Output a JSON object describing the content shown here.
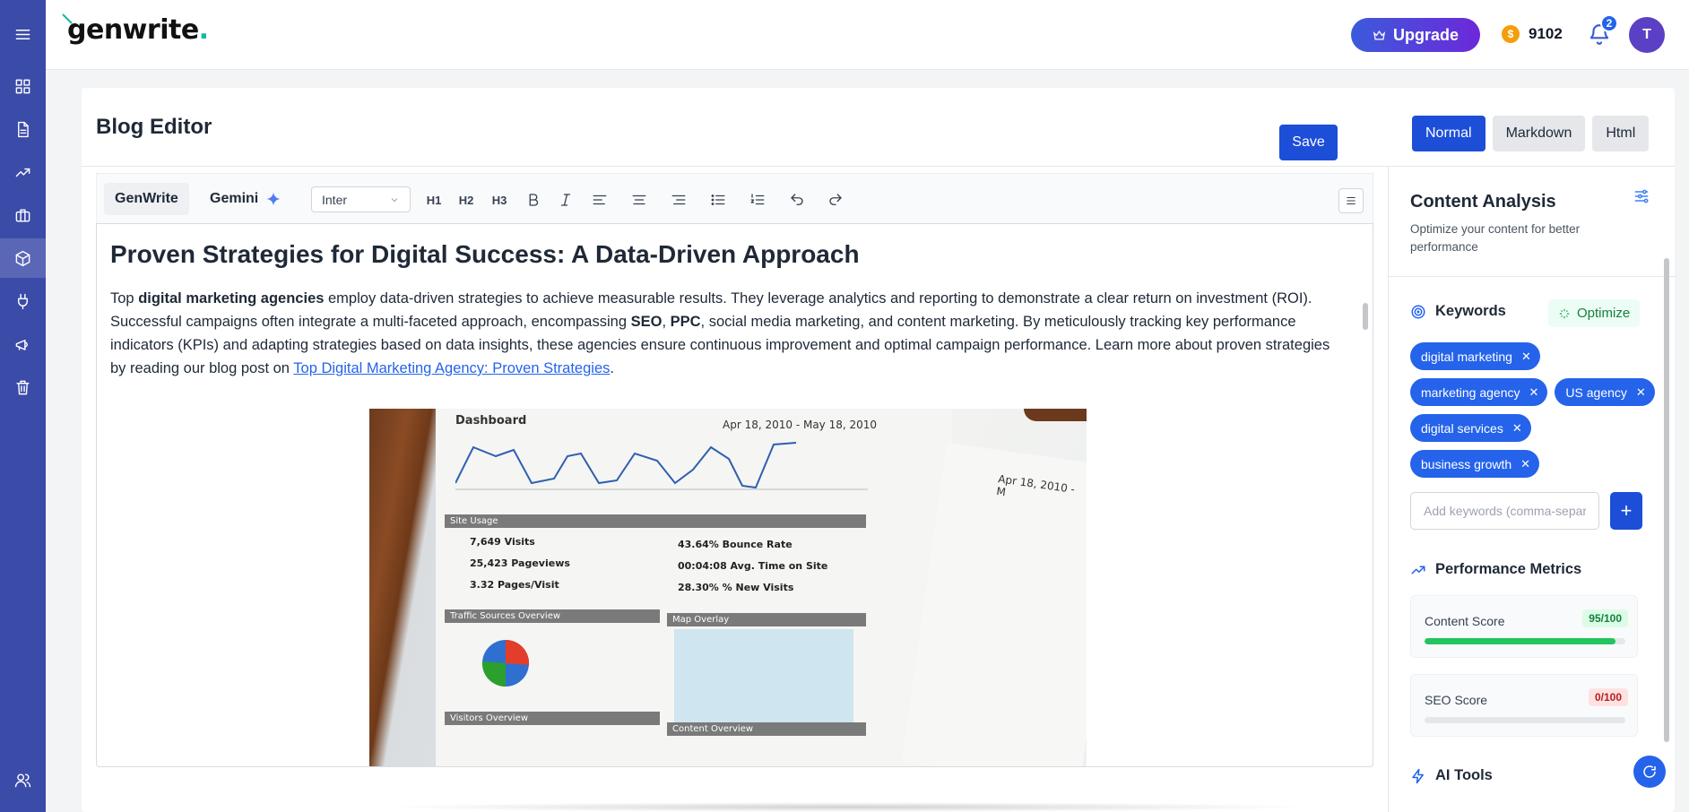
{
  "app": {
    "logo_text": "genwrite",
    "logo_dot": "."
  },
  "topbar": {
    "upgrade_label": "Upgrade",
    "credits": "9102",
    "notifications_count": "2",
    "avatar_initial": "T"
  },
  "editor": {
    "page_title": "Blog Editor",
    "save_label": "Save",
    "modes": [
      {
        "label": "Normal",
        "active": true
      },
      {
        "label": "Markdown",
        "active": false
      },
      {
        "label": "Html",
        "active": false
      }
    ],
    "tabs": {
      "genwrite": "GenWrite",
      "gemini": "Gemini"
    },
    "font": "Inter",
    "toolbar_headings": [
      "H1",
      "H2",
      "H3"
    ]
  },
  "article": {
    "title": "Proven Strategies for Digital Success: A Data-Driven Approach",
    "p_1": "Top ",
    "p_b1": "digital marketing agencies",
    "p_2": " employ data-driven strategies to achieve measurable results. They leverage analytics and reporting to demonstrate a clear return on investment (ROI). Successful campaigns often integrate a multi-faceted approach, encompassing ",
    "p_b2": "SEO",
    "p_3": ", ",
    "p_b3": "PPC",
    "p_4": ", social media marketing, and content marketing. By meticulously tracking key performance indicators (KPIs) and adapting strategies based on data insights, these agencies ensure continuous improvement and optimal campaign performance. Learn more about proven strategies by reading our blog post on ",
    "p_link": "Top Digital Marketing Agency: Proven Strategies",
    "p_5": "."
  },
  "photo": {
    "dash_title": "Dashboard",
    "dash_date": "Apr 18, 2010 - May 18, 2010",
    "site_usage": "Site Usage",
    "stats": [
      "7,649 Visits",
      "25,423 Pageviews",
      "3.32 Pages/Visit",
      "43.64% Bounce Rate",
      "00:04:08 Avg. Time on Site",
      "28.30% % New Visits"
    ],
    "traffic": "Traffic Sources Overview",
    "map": "Map Overlay",
    "visitors": "Visitors Overview",
    "content": "Content Overview",
    "date2": "Apr 18, 2010 - M"
  },
  "panel": {
    "title": "Content Analysis",
    "subtitle": "Optimize your content for better performance",
    "keywords_title": "Keywords",
    "optimize_label": "Optimize",
    "keywords": [
      "digital marketing",
      "marketing agency",
      "US agency",
      "digital services",
      "business growth"
    ],
    "keyword_placeholder": "Add keywords (comma-separated)",
    "add_label": "+",
    "metrics_title": "Performance Metrics",
    "metrics": [
      {
        "label": "Content Score",
        "score": "95/100",
        "value": 95
      },
      {
        "label": "SEO Score",
        "score": "0/100",
        "value": 0
      }
    ],
    "ai_tools_title": "AI Tools"
  },
  "colors": {
    "rail": "#3b4ba8",
    "primary": "#1d4ed8",
    "chip": "#2563eb",
    "success": "#22c55e"
  }
}
